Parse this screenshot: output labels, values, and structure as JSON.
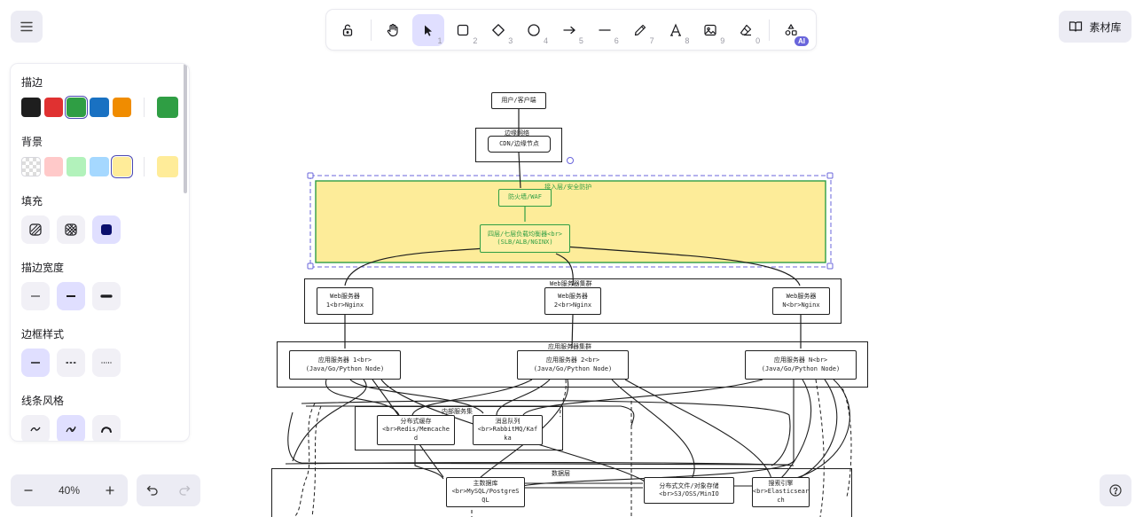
{
  "toolbar": {
    "tools": [
      {
        "name": "lock",
        "key": ""
      },
      {
        "name": "hand",
        "key": ""
      },
      {
        "name": "selection",
        "key": "1"
      },
      {
        "name": "rectangle",
        "key": "2"
      },
      {
        "name": "diamond",
        "key": "3"
      },
      {
        "name": "ellipse",
        "key": "4"
      },
      {
        "name": "arrow",
        "key": "5"
      },
      {
        "name": "line",
        "key": "6"
      },
      {
        "name": "pencil",
        "key": "7"
      },
      {
        "name": "text",
        "key": "8"
      },
      {
        "name": "image",
        "key": "9"
      },
      {
        "name": "eraser",
        "key": "0"
      }
    ],
    "ai_badge": "AI"
  },
  "library": {
    "label": "素材库"
  },
  "properties": {
    "stroke": {
      "title": "描边",
      "colors": [
        "#1e1e1e",
        "#e03131",
        "#2f9e44",
        "#1971c2",
        "#f08c00"
      ],
      "selected": "#2f9e44"
    },
    "background": {
      "title": "背景",
      "colors": [
        "transparent",
        "#ffc9c9",
        "#b2f2bb",
        "#a5d8ff",
        "#ffec99"
      ],
      "selected": "#ffec99"
    },
    "fill": {
      "title": "填充"
    },
    "stroke_width": {
      "title": "描边宽度"
    },
    "stroke_style": {
      "title": "边框样式"
    },
    "sloppiness": {
      "title": "线条风格"
    }
  },
  "zoom": {
    "label": "40%"
  },
  "diagram": {
    "nodes": {
      "client": "用户/客户端",
      "cdn_group": "边缘网络",
      "cdn": "CDN/边缘节点",
      "access_group": "接入层/安全防护",
      "waf": "防火墙/WAF",
      "lb_line1": "四层/七层负载均衡器<br>",
      "lb_line2": "(SLB/ALB/NGINX)",
      "web_group": "Web服务器集群",
      "web1_line1": "Web服务器",
      "web1_line2": "1<br>Nginx",
      "web2_line1": "Web服务器",
      "web2_line2": "2<br>Nginx",
      "webn_line1": "Web服务器",
      "webn_line2": "N<br>Nginx",
      "app_group": "应用服务器集群",
      "app1_line1": "应用服务器 1<br>",
      "app1_line2": "(Java/Go/Python Node)",
      "app2_line1": "应用服务器 2<br>",
      "app2_line2": "(Java/Go/Python Node)",
      "appn_line1": "应用服务器 N<br>",
      "appn_line2": "(Java/Go/Python Node)",
      "mw_group": "内部服务集",
      "cache_line1": "分布式缓存",
      "cache_line2": "<br>Redis/Memcache",
      "cache_line3": "d",
      "mq_line1": "消息队列",
      "mq_line2": "<br>RabbitMQ/Kaf",
      "mq_line3": "ka",
      "data_group": "数据层",
      "db_line1": "主数据库",
      "db_line2": "<br>MySQL/PostgreS",
      "db_line3": "QL",
      "oss_line1": "分布式文件/对象存储",
      "oss_line2": "<br>S3/OSS/MinIO",
      "es_line1": "搜索引擎",
      "es_line2": "<br>Elasticsear",
      "es_line3": "ch"
    }
  }
}
